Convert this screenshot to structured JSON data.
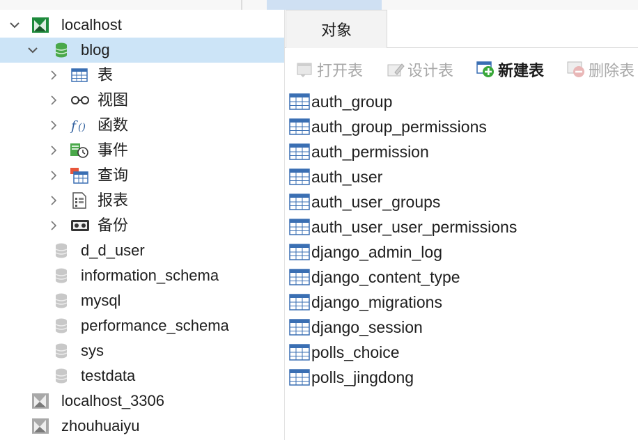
{
  "tree": {
    "connection": "localhost",
    "database": "blog",
    "children": [
      "表",
      "视图",
      "函数",
      "事件",
      "查询",
      "报表",
      "备份"
    ],
    "other_databases": [
      "d_d_user",
      "information_schema",
      "mysql",
      "performance_schema",
      "sys",
      "testdata"
    ],
    "other_connections": [
      "localhost_3306",
      "zhouhuaiyu"
    ]
  },
  "tabs": {
    "objects": "对象"
  },
  "toolbar": {
    "open_table": "打开表",
    "design_table": "设计表",
    "new_table": "新建表",
    "delete_table": "删除表"
  },
  "tables": [
    "auth_group",
    "auth_group_permissions",
    "auth_permission",
    "auth_user",
    "auth_user_groups",
    "auth_user_user_permissions",
    "django_admin_log",
    "django_content_type",
    "django_migrations",
    "django_session",
    "polls_choice",
    "polls_jingdong"
  ],
  "colors": {
    "selection": "#cce4f7",
    "connection_green": "#1e8a3c",
    "database_green": "#4aa84a",
    "table_icon_blue": "#3a6fb3"
  }
}
